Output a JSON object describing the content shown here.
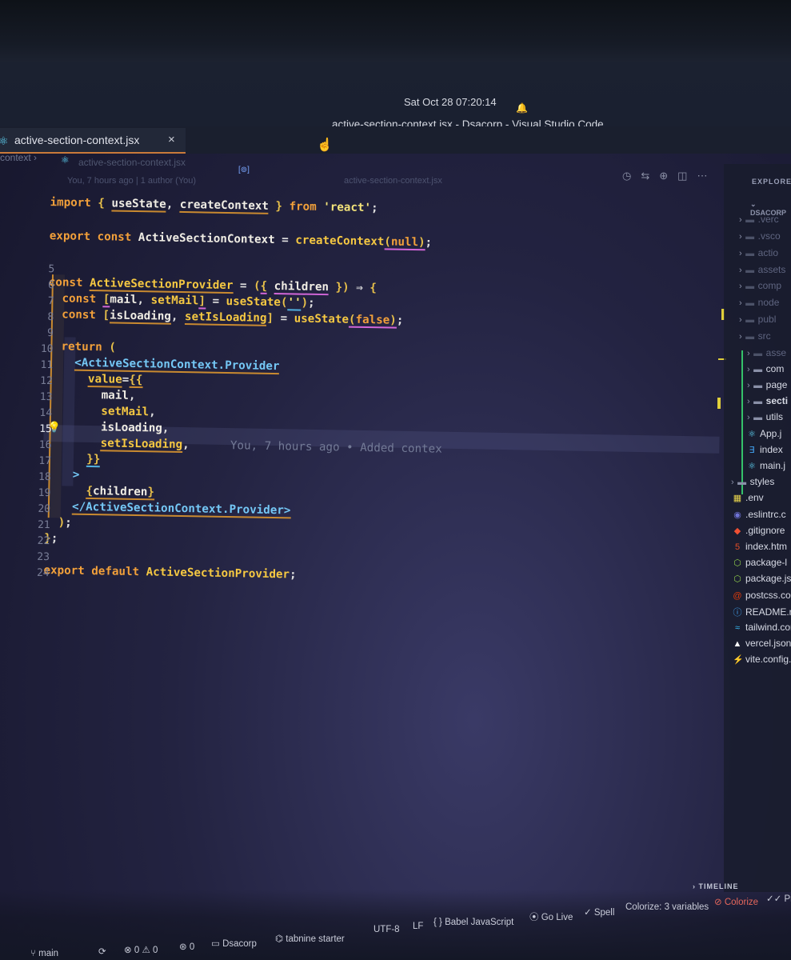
{
  "system": {
    "clock": "Sat Oct 28  07:20:14",
    "window_title": "active-section-context.jsx - Dsacorp - Visual Studio Code"
  },
  "tab": {
    "label": "active-section-context.jsx",
    "close": "×"
  },
  "breadcrumbs": {
    "folder": "context",
    "sep": "›",
    "file": "active-section-context.jsx"
  },
  "codelens": {
    "left": "You, 7 hours ago | 1 author (You)",
    "right": "active-section-context.jsx"
  },
  "editor": {
    "line_numbers": [
      "5",
      "6",
      "7",
      "8",
      "9",
      "10",
      "11",
      "12",
      "13",
      "14",
      "15",
      "16",
      "17",
      "18",
      "19",
      "20",
      "21",
      "22",
      "23",
      "24"
    ],
    "current_line": "15",
    "blame": "You, 7 hours ago • Added contex"
  },
  "explorer": {
    "title": "EXPLORER",
    "project": "DSACORP",
    "items": [
      {
        "label": ".verc",
        "icon": "folder",
        "dim": true
      },
      {
        "label": ".vsco",
        "icon": "folder",
        "dim": true
      },
      {
        "label": "actio",
        "icon": "folder",
        "dim": true
      },
      {
        "label": "assets",
        "icon": "folder",
        "dim": true
      },
      {
        "label": "comp",
        "icon": "folder",
        "dim": true
      },
      {
        "label": "node",
        "icon": "folder",
        "dim": true
      },
      {
        "label": "publ",
        "icon": "folder",
        "dim": true
      },
      {
        "label": "src",
        "icon": "folder",
        "dim": true
      },
      {
        "label": "asse",
        "icon": "folder",
        "dim": true
      },
      {
        "label": "com",
        "icon": "folder",
        "dim": false
      },
      {
        "label": "page",
        "icon": "folder",
        "dim": false
      },
      {
        "label": "secti",
        "icon": "folder",
        "dim": false
      },
      {
        "label": "utils",
        "icon": "folder",
        "dim": false
      },
      {
        "label": "App.j",
        "icon": "react",
        "dim": false
      },
      {
        "label": "index",
        "icon": "css",
        "dim": false
      },
      {
        "label": "main.j",
        "icon": "react",
        "dim": false
      },
      {
        "label": "styles",
        "icon": "folder",
        "dim": false
      },
      {
        "label": ".env",
        "icon": "env",
        "dim": false
      },
      {
        "label": ".eslintrc.c",
        "icon": "eslint",
        "dim": false
      },
      {
        "label": ".gitignore",
        "icon": "git",
        "dim": false
      },
      {
        "label": "index.htm",
        "icon": "html",
        "dim": false
      },
      {
        "label": "package-l",
        "icon": "node",
        "dim": false
      },
      {
        "label": "package.js",
        "icon": "node",
        "dim": false
      },
      {
        "label": "postcss.cor",
        "icon": "postcss",
        "dim": false
      },
      {
        "label": "README.m",
        "icon": "info",
        "dim": false
      },
      {
        "label": "tailwind.cor",
        "icon": "tailwind",
        "dim": false
      },
      {
        "label": "vercel.json",
        "icon": "vercel",
        "dim": false
      },
      {
        "label": "vite.config.js",
        "icon": "vite",
        "dim": false
      }
    ],
    "timeline": "TIMELINE"
  },
  "status": {
    "branch": "main",
    "errors": "0",
    "warnings": "0",
    "ports": "0",
    "workspace": "Dsacorp",
    "tabnine": "tabnine starter",
    "encoding": "UTF-8",
    "eol": "LF",
    "language": "Babel JavaScript",
    "golive": "Go Live",
    "spell": "Spell",
    "colorize_count": "Colorize: 3 variables",
    "colorize": "Colorize",
    "prettier": "Pre"
  },
  "colors": {
    "keyword": "#f2a03a",
    "function": "#f5c842",
    "jsx_tag": "#74c7f5",
    "string": "#f3e37a"
  }
}
